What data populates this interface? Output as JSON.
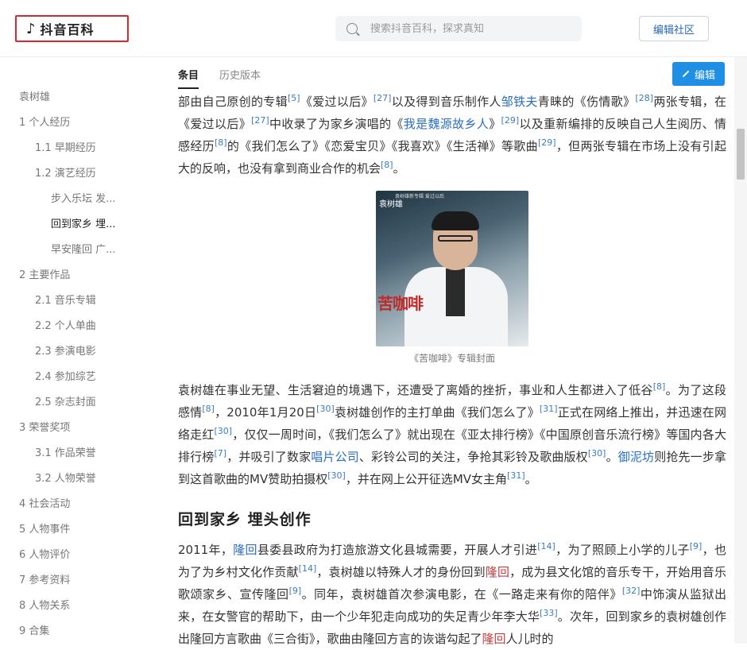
{
  "header": {
    "logo_text": "抖音百科",
    "search_placeholder": "搜索抖音百科，探求真知",
    "community_button": "编辑社区"
  },
  "tabs": [
    {
      "label": "条目",
      "active": true
    },
    {
      "label": "历史版本",
      "active": false
    }
  ],
  "edit_button": "编辑",
  "toc": [
    {
      "label": "袁树雄",
      "level": 0
    },
    {
      "label": "1 个人经历",
      "level": 0
    },
    {
      "label": "1.1 早期经历",
      "level": 1
    },
    {
      "label": "1.2 演艺经历",
      "level": 1
    },
    {
      "label": "步入乐坛 发...",
      "level": 2
    },
    {
      "label": "回到家乡 埋...",
      "level": 2,
      "active": true
    },
    {
      "label": "早安隆回 广...",
      "level": 2
    },
    {
      "label": "2 主要作品",
      "level": 0
    },
    {
      "label": "2.1 音乐专辑",
      "level": 1
    },
    {
      "label": "2.2 个人单曲",
      "level": 1
    },
    {
      "label": "2.3 参演电影",
      "level": 1
    },
    {
      "label": "2.4 参加综艺",
      "level": 1
    },
    {
      "label": "2.5 杂志封面",
      "level": 1
    },
    {
      "label": "3 荣誉奖项",
      "level": 0
    },
    {
      "label": "3.1 作品荣誉",
      "level": 1
    },
    {
      "label": "3.2 人物荣誉",
      "level": 1
    },
    {
      "label": "4 社会活动",
      "level": 0
    },
    {
      "label": "5 人物事件",
      "level": 0
    },
    {
      "label": "6 人物评价",
      "level": 0
    },
    {
      "label": "7 参考资料",
      "level": 0
    },
    {
      "label": "8 人物关系",
      "level": 0
    },
    {
      "label": "9 合集",
      "level": 0
    }
  ],
  "article": {
    "p1": {
      "t1": "部由自己原创的专辑",
      "s1": "[5]",
      "t2": "《爱过以后》",
      "s2": "[27]",
      "t3": "以及得到音乐制作人",
      "link1": "邹铁夫",
      "t4": "青睐的《伤情歌》",
      "s3": "[28]",
      "t5": "两张专辑，在《爱过以后》",
      "s4": "[27]",
      "t6": "中收录了为家乡演唱的《",
      "link2": "我是魏源故乡人",
      "t7": "》",
      "s5": "[29]",
      "t8": "以及重新编排的反映自己人生阅历、情感经历",
      "s6": "[8]",
      "t9": "的《我们怎么了》《恋爱宝贝》《我喜欢》《生活禅》等歌曲",
      "s7": "[29]",
      "t10": "，但两张专辑在市场上没有引起大的反响，也没有拿到商业合作的机会",
      "s8": "[8]",
      "t11": "。"
    },
    "figure": {
      "cover_name": "袁树雄",
      "cover_topline": "袁树雄新专辑 爱过以后",
      "cover_title": "苦咖啡",
      "caption": "《苦咖啡》专辑封面"
    },
    "p2": {
      "t1": "袁树雄在事业无望、生活窘迫的境遇下，还遭受了离婚的挫折，事业和人生都进入了低谷",
      "s1": "[8]",
      "t2": "。为了这段感情",
      "s2": "[8]",
      "t3": "，2010年1月20日",
      "s3": "[30]",
      "t4": "袁树雄创作的主打单曲《我们怎么了》",
      "s4": "[31]",
      "t5": "正式在网络上推出，并迅速在网络走红",
      "s5": "[30]",
      "t6": "，仅仅一周时间，《我们怎么了》就出现在《亚太排行榜》《中国原创音乐流行榜》等国内各大排行榜",
      "s6": "[7]",
      "t7": "，并吸引了数家",
      "link1": "唱片公司",
      "t8": "、彩铃公司的关注，争抢其彩铃及歌曲版权",
      "s7": "[30]",
      "t9": "。",
      "link2": "御泥坊",
      "t10": "则抢先一步拿到这首歌曲的MV赞助拍摄权",
      "s8": "[30]",
      "t11": "，并在网上公开征选MV女主角",
      "s9": "[31]",
      "t12": "。"
    },
    "heading": "回到家乡 埋头创作",
    "p3": {
      "t1": "2011年，",
      "link1": "隆回",
      "t2": "县委县政府为打造旅游文化县城需要，开展人才引进",
      "s1": "[14]",
      "t3": "，为了照顾上小学的儿子",
      "s2": "[9]",
      "t4": "，也为了为乡村文化作贡献",
      "s3": "[14]",
      "t5": "，袁树雄以特殊人才的身份回到",
      "red1": "隆回",
      "t6": "，成为县文化馆的音乐专干，开始用音乐歌颂家乡、宣传隆回",
      "s4": "[9]",
      "t7": "。同年，袁树雄首次参演电影，在《一路走来有你的陪伴》",
      "s5": "[32]",
      "t8": "中饰演从监狱出来，在女警官的帮助下，由一个少年犯走向成功的失足青少年李大华",
      "s6": "[33]",
      "t9": "。次年，回到家乡的袁树雄创作出隆回方言歌曲《三合街》，歌曲由隆回方言的诙谐勾起了",
      "red2": "隆回",
      "t10": "人儿时的"
    }
  }
}
